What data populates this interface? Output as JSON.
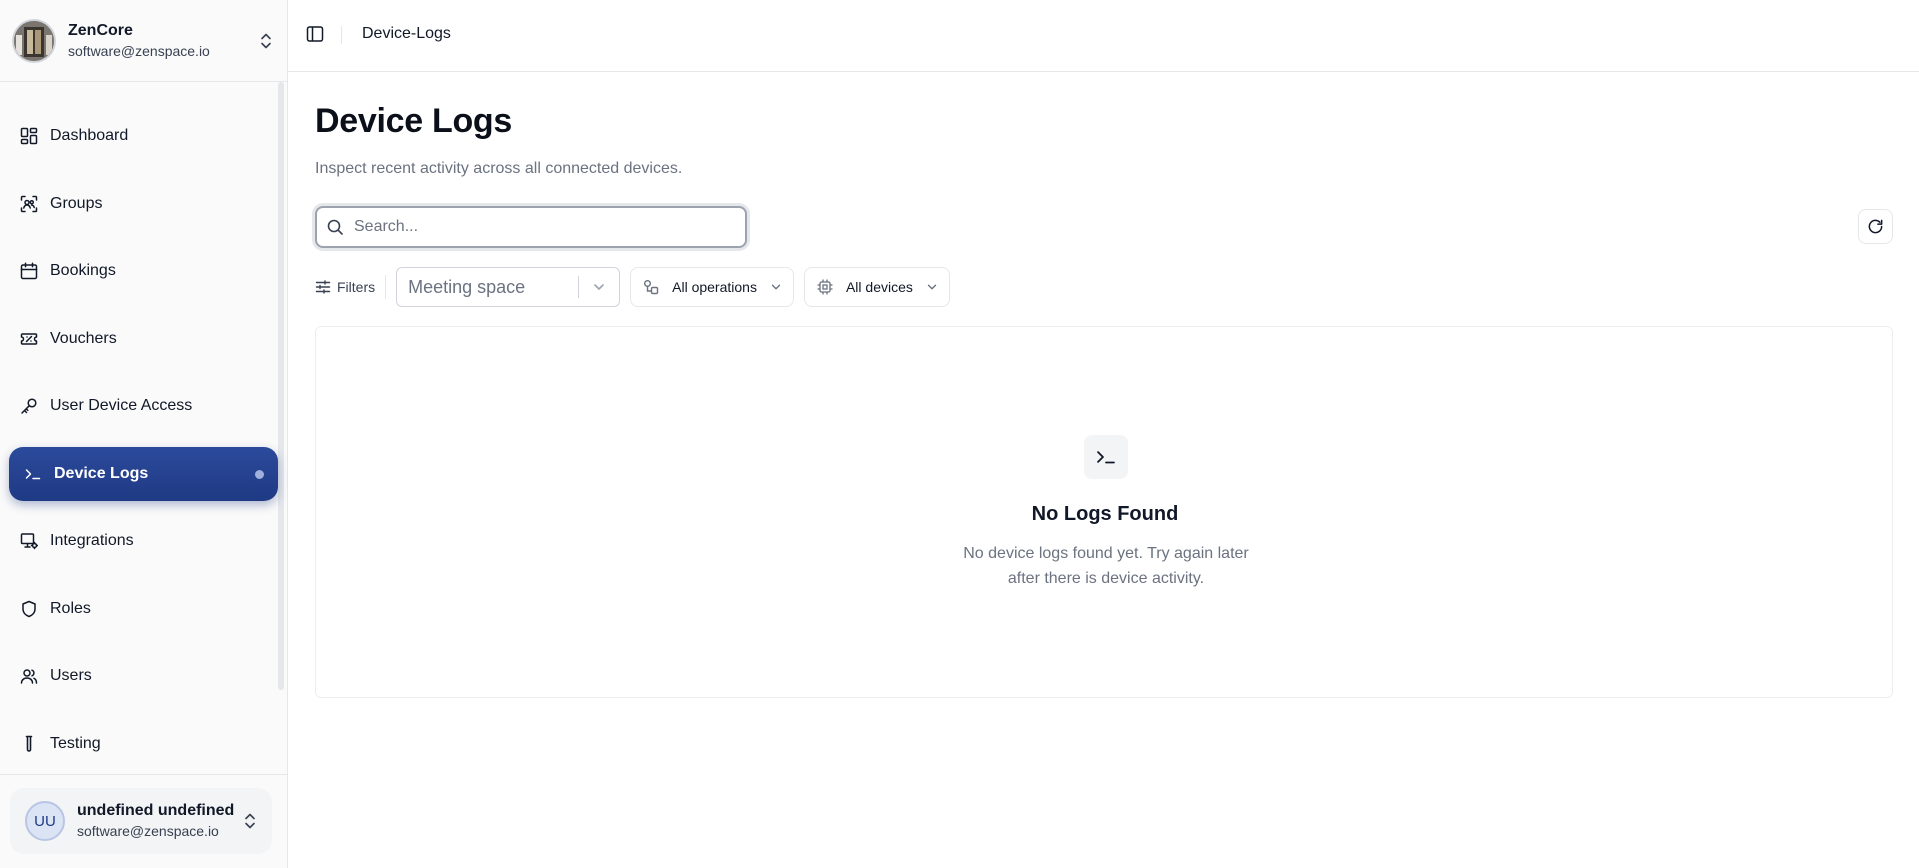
{
  "sidebar": {
    "org": {
      "name": "ZenCore",
      "email": "software@zenspace.io"
    },
    "items": [
      {
        "label": "Dashboard",
        "icon": "dashboard-icon"
      },
      {
        "label": "Groups",
        "icon": "groups-icon"
      },
      {
        "label": "Bookings",
        "icon": "calendar-icon"
      },
      {
        "label": "Vouchers",
        "icon": "ticket-icon"
      },
      {
        "label": "User Device Access",
        "icon": "key-icon"
      },
      {
        "label": "Device Logs",
        "icon": "terminal-icon",
        "active": true
      },
      {
        "label": "Integrations",
        "icon": "integrations-icon"
      },
      {
        "label": "Roles",
        "icon": "shield-icon"
      },
      {
        "label": "Users",
        "icon": "users-icon"
      },
      {
        "label": "Testing",
        "icon": "test-tube-icon"
      }
    ],
    "user": {
      "initials": "UU",
      "name": "undefined undefined",
      "email": "software@zenspace.io"
    }
  },
  "topbar": {
    "breadcrumb": "Device-Logs"
  },
  "main": {
    "title": "Device Logs",
    "subtitle": "Inspect recent activity across all connected devices.",
    "search": {
      "placeholder": "Search...",
      "value": ""
    },
    "filters": {
      "label": "Filters",
      "space_placeholder": "Meeting space",
      "operations": "All operations",
      "devices": "All devices"
    },
    "empty": {
      "title": "No Logs Found",
      "description": "No device logs found yet. Try again later after there is device activity."
    }
  },
  "colors": {
    "accent": "#1f3a84",
    "active_dot": "#9fb0db",
    "muted_text": "#6b7280",
    "border": "#e5e7eb"
  }
}
